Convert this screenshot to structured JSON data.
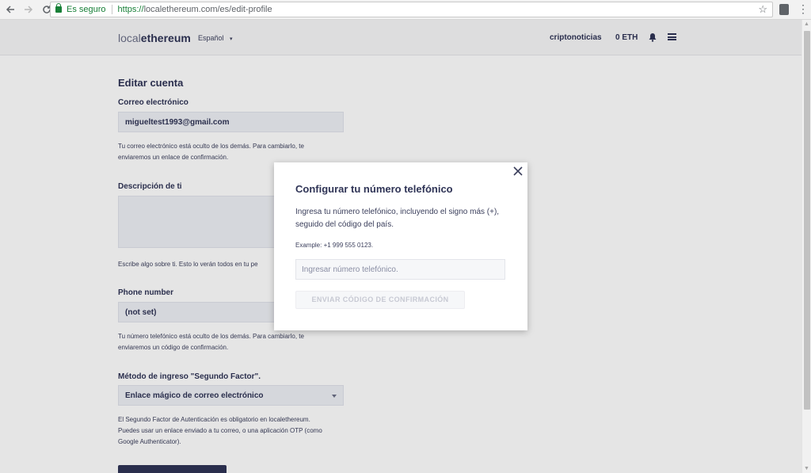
{
  "browser": {
    "secure_text": "Es seguro",
    "url_scheme": "https://",
    "url_rest": "localethereum.com/es/edit-profile",
    "back_icon": "arrow-left-icon",
    "forward_icon": "arrow-right-icon",
    "reload_icon": "reload-icon",
    "bookmark_icon": "star-icon",
    "extension_icon": "shield-icon",
    "menu_icon": "more-vert-icon"
  },
  "header": {
    "logo_light": "local",
    "logo_bold": "ethereum",
    "language": "Español",
    "language_arrow": "▾",
    "username": "criptonoticias",
    "balance": "0 ETH",
    "bell_icon": "bell-icon",
    "menu_icon": "hamburger-icon"
  },
  "form": {
    "title": "Editar cuenta",
    "email_label": "Correo electrónico",
    "email_value": "migueltest1993@gmail.com",
    "email_help_1": "Tu correo electrónico está oculto de los demás. Para cambiarlo, te",
    "email_help_2": "enviaremos un enlace de confirmación.",
    "description_label": "Descripción de ti",
    "description_help": "Escribe algo sobre ti. Esto lo verán todos en tu pe",
    "phone_label": "Phone number",
    "phone_value": "(not set)",
    "phone_help_1": "Tu número telefónico está oculto de los demás. Para cambiarlo, te",
    "phone_help_2": "enviaremos un código de confirmación.",
    "twofa_label": "Método de ingreso \"Segundo Factor\".",
    "twofa_value": "Enlace mágico de correo electrónico",
    "twofa_help_1": "El Segundo Factor de Autenticación es obligatorio en localethereum.",
    "twofa_help_2": "Puedes usar un enlace enviado a tu correo, o una aplicación OTP (como",
    "twofa_help_3": "Google Authenticator)."
  },
  "modal": {
    "title": "Configurar tu número telefónico",
    "description": "Ingresa tu número telefónico, incluyendo el signo más (+), seguido del código del país.",
    "example": "Example: +1 999 555 0123.",
    "input_placeholder": "Ingresar número telefónico.",
    "input_value": "",
    "send_button": "ENVIAR CÓDIGO DE CONFIRMACIÓN",
    "close_icon": "close-icon"
  },
  "colors": {
    "brand_navy": "#2f3456",
    "secure_green": "#188038"
  }
}
